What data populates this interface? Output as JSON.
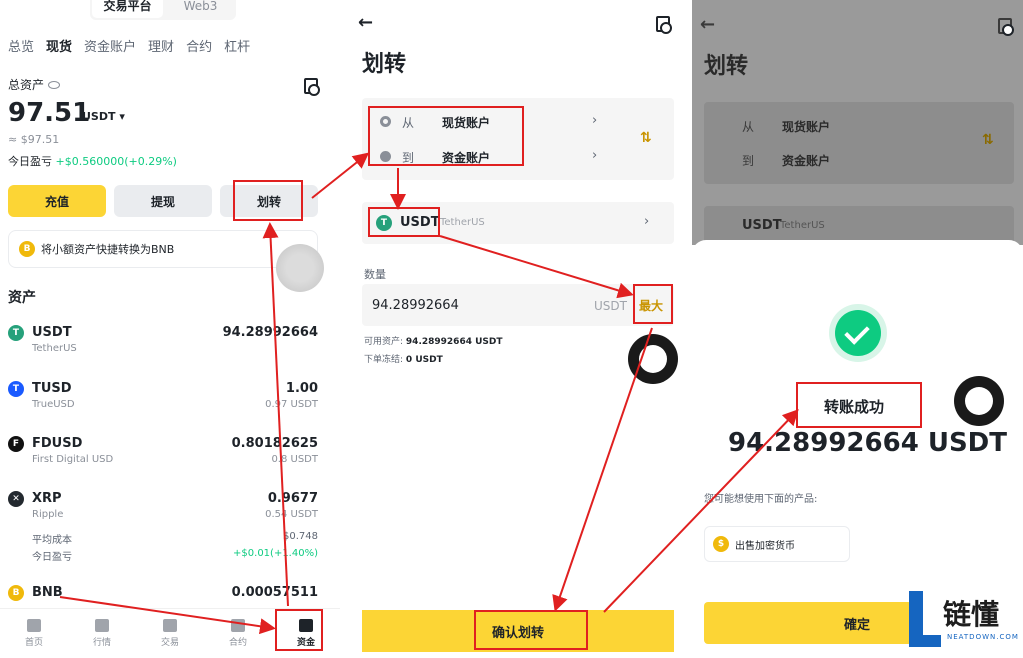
{
  "panel1": {
    "top_tabs": [
      "交易平台",
      "Web3"
    ],
    "nav": [
      "总览",
      "现货",
      "资金账户",
      "理财",
      "合约",
      "杠杆"
    ],
    "total_label": "总资产",
    "balance": "97.51",
    "balance_unit": "USDT ▾",
    "approx": "≈ $97.51",
    "pnl_label": "今日盈亏",
    "pnl_value": "+$0.560000(+0.29%)",
    "buttons": {
      "deposit": "充值",
      "withdraw": "提现",
      "transfer": "划转"
    },
    "promo": "将小额资产快捷转换为BNB",
    "assets_title": "资产",
    "assets": [
      {
        "symbol": "USDT",
        "name": "TetherUS",
        "amount": "94.28992664",
        "sub": ""
      },
      {
        "symbol": "TUSD",
        "name": "TrueUSD",
        "amount": "1.00",
        "sub": "0.97 USDT"
      },
      {
        "symbol": "FDUSD",
        "name": "First Digital USD",
        "amount": "0.80182625",
        "sub": "0.8 USDT"
      },
      {
        "symbol": "XRP",
        "name": "Ripple",
        "amount": "0.9677",
        "sub": "0.54 USDT"
      },
      {
        "symbol": "BNB",
        "name": "",
        "amount": "0.00057511",
        "sub": ""
      }
    ],
    "xrp_extra": {
      "cost_label": "平均成本",
      "cost_value": "$0.748",
      "pnl_label": "今日盈亏",
      "pnl_value": "+$0.01(+1.40%)"
    },
    "bottom_nav": [
      "首页",
      "行情",
      "交易",
      "合约",
      "资金"
    ]
  },
  "panel2": {
    "title": "划转",
    "from_label": "从",
    "from_value": "现货账户",
    "to_label": "到",
    "to_value": "资金账户",
    "coin": "USDT",
    "coin_name": "TetherUS",
    "qty_label": "数量",
    "qty_value": "94.28992664",
    "qty_unit": "USDT",
    "max_label": "最大",
    "available_label": "可用资产:",
    "available_value": "94.28992664 USDT",
    "frozen_label": "下单冻结:",
    "frozen_value": "0 USDT",
    "confirm": "确认划转"
  },
  "panel3": {
    "title": "划转",
    "from_label": "从",
    "from_value": "现货账户",
    "to_label": "到",
    "to_value": "资金账户",
    "coin": "USDT",
    "coin_name": "TetherUS",
    "success": "转账成功",
    "amount": "94.28992664 USDT",
    "suggest": "您可能想使用下面的产品:",
    "product": "出售加密货币",
    "ok": "確定"
  },
  "watermark": {
    "name": "链懂",
    "domain": "NEATDOWN.COM"
  },
  "colors": {
    "accent_yellow": "#fcd535",
    "gain_green": "#0ecb81",
    "annotation_red": "#e02020",
    "brand_blue": "#1565c0"
  }
}
